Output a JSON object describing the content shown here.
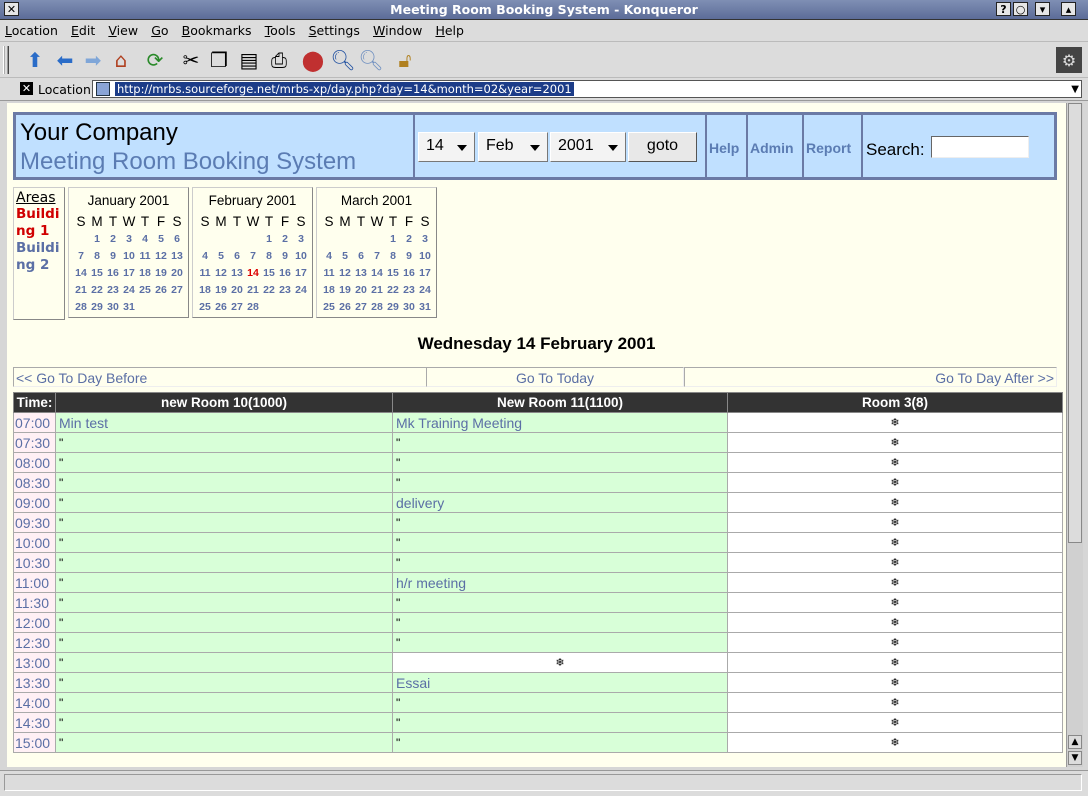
{
  "window": {
    "title": "Meeting Room Booking System - Konqueror"
  },
  "menu": [
    "Location",
    "Edit",
    "View",
    "Go",
    "Bookmarks",
    "Tools",
    "Settings",
    "Window",
    "Help"
  ],
  "location": {
    "label": "Location",
    "url": "http://mrbs.sourceforge.net/mrbs-xp/day.php?day=14&month=02&year=2001"
  },
  "banner": {
    "company": "Your Company",
    "system": "Meeting Room Booking System",
    "day": "14",
    "month": "Feb",
    "year": "2001",
    "goto": "goto",
    "help": "Help",
    "admin": "Admin",
    "report": "Report",
    "search_label": "Search:"
  },
  "areas": {
    "heading": "Areas",
    "items": [
      {
        "label": "Buildi ng 1",
        "line1": "Buildi",
        "line2": "ng 1",
        "current": true
      },
      {
        "label": "Buildi ng 2",
        "line1": "Buildi",
        "line2": "ng 2",
        "current": false
      }
    ]
  },
  "calendars": [
    {
      "title": "January 2001",
      "weekdays": [
        "S",
        "M",
        "T",
        "W",
        "T",
        "F",
        "S"
      ],
      "weeks": [
        [
          "",
          "1",
          "2",
          "3",
          "4",
          "5",
          "6"
        ],
        [
          "7",
          "8",
          "9",
          "10",
          "11",
          "12",
          "13"
        ],
        [
          "14",
          "15",
          "16",
          "17",
          "18",
          "19",
          "20"
        ],
        [
          "21",
          "22",
          "23",
          "24",
          "25",
          "26",
          "27"
        ],
        [
          "28",
          "29",
          "30",
          "31",
          "",
          "",
          ""
        ]
      ]
    },
    {
      "title": "February 2001",
      "weekdays": [
        "S",
        "M",
        "T",
        "W",
        "T",
        "F",
        "S"
      ],
      "today": "14",
      "weeks": [
        [
          "",
          "",
          "",
          "",
          "1",
          "2",
          "3"
        ],
        [
          "4",
          "5",
          "6",
          "7",
          "8",
          "9",
          "10"
        ],
        [
          "11",
          "12",
          "13",
          "14",
          "15",
          "16",
          "17"
        ],
        [
          "18",
          "19",
          "20",
          "21",
          "22",
          "23",
          "24"
        ],
        [
          "25",
          "26",
          "27",
          "28",
          "",
          "",
          ""
        ]
      ]
    },
    {
      "title": "March 2001",
      "weekdays": [
        "S",
        "M",
        "T",
        "W",
        "T",
        "F",
        "S"
      ],
      "weeks": [
        [
          "",
          "",
          "",
          "",
          "1",
          "2",
          "3"
        ],
        [
          "4",
          "5",
          "6",
          "7",
          "8",
          "9",
          "10"
        ],
        [
          "11",
          "12",
          "13",
          "14",
          "15",
          "16",
          "17"
        ],
        [
          "18",
          "19",
          "20",
          "21",
          "22",
          "23",
          "24"
        ],
        [
          "25",
          "26",
          "27",
          "28",
          "29",
          "30",
          "31"
        ]
      ]
    }
  ],
  "day_heading": "Wednesday 14 February 2001",
  "nav": {
    "before": "<< Go To Day Before",
    "today": "Go To Today",
    "after": "Go To Day After >>"
  },
  "grid": {
    "headers": [
      "Time:",
      "new Room 10(1000)",
      "New Room 11(1100)",
      "Room 3(8)"
    ],
    "rows": [
      {
        "time": "07:00",
        "r1": {
          "t": "book",
          "v": "Min test"
        },
        "r2": {
          "t": "book",
          "v": "Mk Training Meeting"
        },
        "r3": {
          "t": "free",
          "v": "❄"
        }
      },
      {
        "time": "07:30",
        "r1": {
          "t": "cont",
          "v": "\""
        },
        "r2": {
          "t": "cont",
          "v": "\""
        },
        "r3": {
          "t": "free",
          "v": "❄"
        }
      },
      {
        "time": "08:00",
        "r1": {
          "t": "cont",
          "v": "\""
        },
        "r2": {
          "t": "cont",
          "v": "\""
        },
        "r3": {
          "t": "free",
          "v": "❄"
        }
      },
      {
        "time": "08:30",
        "r1": {
          "t": "cont",
          "v": "\""
        },
        "r2": {
          "t": "cont",
          "v": "\""
        },
        "r3": {
          "t": "free",
          "v": "❄"
        }
      },
      {
        "time": "09:00",
        "r1": {
          "t": "cont",
          "v": "\""
        },
        "r2": {
          "t": "book",
          "v": "delivery"
        },
        "r3": {
          "t": "free",
          "v": "❄"
        }
      },
      {
        "time": "09:30",
        "r1": {
          "t": "cont",
          "v": "\""
        },
        "r2": {
          "t": "cont",
          "v": "\""
        },
        "r3": {
          "t": "free",
          "v": "❄"
        }
      },
      {
        "time": "10:00",
        "r1": {
          "t": "cont",
          "v": "\""
        },
        "r2": {
          "t": "cont",
          "v": "\""
        },
        "r3": {
          "t": "free",
          "v": "❄"
        }
      },
      {
        "time": "10:30",
        "r1": {
          "t": "cont",
          "v": "\""
        },
        "r2": {
          "t": "cont",
          "v": "\""
        },
        "r3": {
          "t": "free",
          "v": "❄"
        }
      },
      {
        "time": "11:00",
        "r1": {
          "t": "cont",
          "v": "\""
        },
        "r2": {
          "t": "book",
          "v": "h/r meeting"
        },
        "r3": {
          "t": "free",
          "v": "❄"
        }
      },
      {
        "time": "11:30",
        "r1": {
          "t": "cont",
          "v": "\""
        },
        "r2": {
          "t": "cont",
          "v": "\""
        },
        "r3": {
          "t": "free",
          "v": "❄"
        }
      },
      {
        "time": "12:00",
        "r1": {
          "t": "cont",
          "v": "\""
        },
        "r2": {
          "t": "cont",
          "v": "\""
        },
        "r3": {
          "t": "free",
          "v": "❄"
        }
      },
      {
        "time": "12:30",
        "r1": {
          "t": "cont",
          "v": "\""
        },
        "r2": {
          "t": "cont",
          "v": "\""
        },
        "r3": {
          "t": "free",
          "v": "❄"
        }
      },
      {
        "time": "13:00",
        "r1": {
          "t": "cont",
          "v": "\""
        },
        "r2": {
          "t": "free",
          "v": "❄"
        },
        "r3": {
          "t": "free",
          "v": "❄"
        }
      },
      {
        "time": "13:30",
        "r1": {
          "t": "cont",
          "v": "\""
        },
        "r2": {
          "t": "book",
          "v": "Essai"
        },
        "r3": {
          "t": "free",
          "v": "❄"
        }
      },
      {
        "time": "14:00",
        "r1": {
          "t": "cont",
          "v": "\""
        },
        "r2": {
          "t": "cont",
          "v": "\""
        },
        "r3": {
          "t": "free",
          "v": "❄"
        }
      },
      {
        "time": "14:30",
        "r1": {
          "t": "cont",
          "v": "\""
        },
        "r2": {
          "t": "cont",
          "v": "\""
        },
        "r3": {
          "t": "free",
          "v": "❄"
        }
      },
      {
        "time": "15:00",
        "r1": {
          "t": "cont",
          "v": "\""
        },
        "r2": {
          "t": "cont",
          "v": "\""
        },
        "r3": {
          "t": "free",
          "v": "❄"
        }
      }
    ]
  }
}
